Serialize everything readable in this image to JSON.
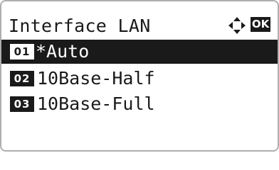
{
  "header": {
    "title": "Interface LAN",
    "nav_icon": "four-way-arrow-icon",
    "ok_label": "OK"
  },
  "menu": {
    "items": [
      {
        "number": "01",
        "label": "*Auto",
        "selected": true
      },
      {
        "number": "02",
        "label": "10Base-Half",
        "selected": false
      },
      {
        "number": "03",
        "label": "10Base-Full",
        "selected": false
      }
    ]
  },
  "colors": {
    "foreground": "#1a1a1a",
    "background": "#ffffff",
    "frame": "#aeaeae"
  }
}
